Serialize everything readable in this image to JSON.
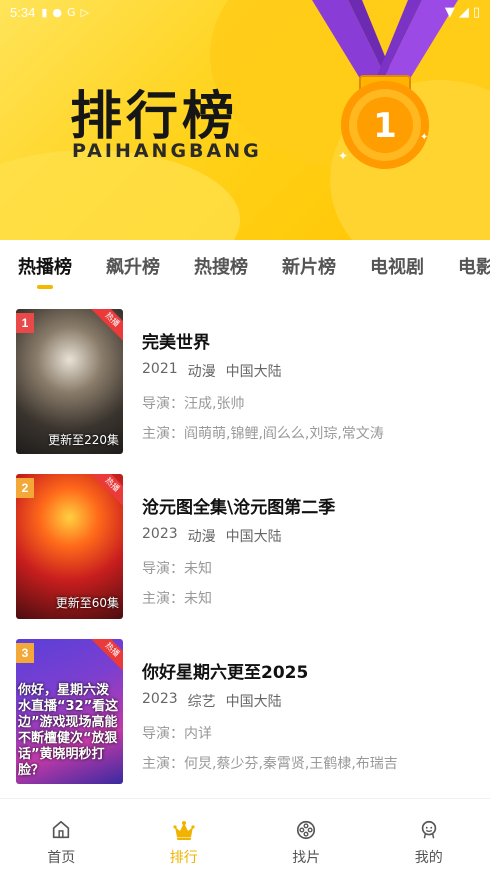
{
  "status_bar": {
    "time": "5:34"
  },
  "banner": {
    "title": "排行榜",
    "subtitle": "PAIHANGBANG",
    "medal_number": "1"
  },
  "tabs": [
    {
      "label": "热播榜",
      "active": true
    },
    {
      "label": "飙升榜",
      "active": false
    },
    {
      "label": "热搜榜",
      "active": false
    },
    {
      "label": "新片榜",
      "active": false
    },
    {
      "label": "电视剧",
      "active": false
    },
    {
      "label": "电影",
      "active": false
    }
  ],
  "list": [
    {
      "rank": "1",
      "badge": "热播",
      "poster_caption": "更新至220集",
      "poster_overlay": "",
      "title": "完美世界",
      "year": "2021",
      "genre": "动漫",
      "region": "中国大陆",
      "director": "导演：汪成,张帅",
      "cast": "主演：阎萌萌,锦鲤,阎么么,刘琮,常文涛"
    },
    {
      "rank": "2",
      "badge": "热播",
      "poster_caption": "更新至60集",
      "poster_overlay": "",
      "title": "沧元图全集\\沧元图第二季",
      "year": "2023",
      "genre": "动漫",
      "region": "中国大陆",
      "director": "导演：未知",
      "cast": "主演：未知"
    },
    {
      "rank": "3",
      "badge": "热播",
      "poster_caption": "",
      "poster_overlay": "你好，星期六泼水直播“32”看这边”游戏现场高能不断檀健次“放狠话”黄晓明秒打脸？",
      "title": "你好星期六更至2025",
      "year": "2023",
      "genre": "综艺",
      "region": "中国大陆",
      "director": "导演：内详",
      "cast": "主演：何炅,蔡少芬,秦霄贤,王鹤棣,布瑞吉"
    }
  ],
  "nav": [
    {
      "label": "首页",
      "icon": "home-icon",
      "active": false
    },
    {
      "label": "排行",
      "icon": "crown-icon",
      "active": true
    },
    {
      "label": "找片",
      "icon": "film-reel-icon",
      "active": false
    },
    {
      "label": "我的",
      "icon": "profile-icon",
      "active": false
    }
  ],
  "colors": {
    "accent": "#f0b400",
    "badge": "#ea3a3a",
    "rank1": "#e84a4a",
    "rank2": "#f2a93a",
    "rank3": "#f2a93a"
  }
}
